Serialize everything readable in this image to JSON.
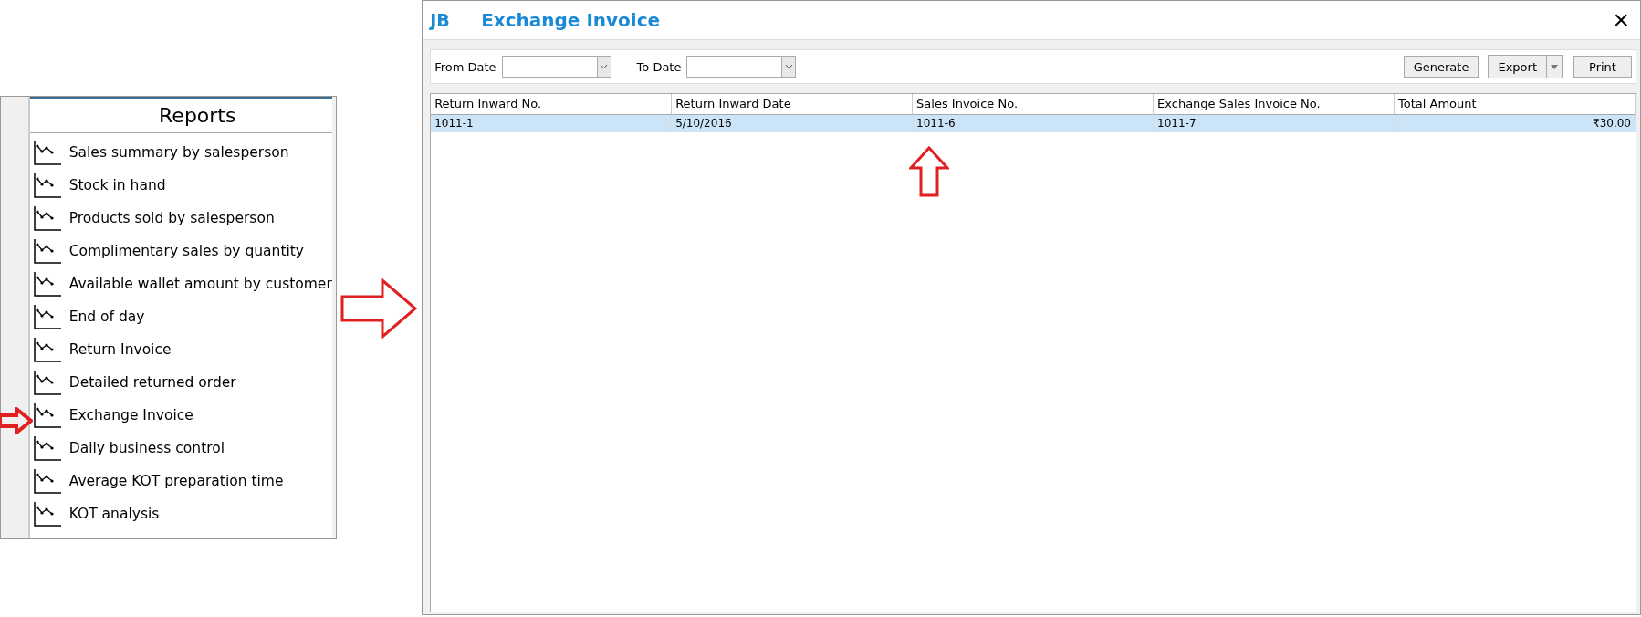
{
  "reports_panel": {
    "title": "Reports",
    "items": [
      {
        "label": "Sales summary by salesperson"
      },
      {
        "label": "Stock in hand"
      },
      {
        "label": "Products sold by salesperson"
      },
      {
        "label": "Complimentary sales by quantity"
      },
      {
        "label": "Available wallet amount by customer"
      },
      {
        "label": "End of day"
      },
      {
        "label": "Return Invoice"
      },
      {
        "label": "Detailed returned order"
      },
      {
        "label": "Exchange Invoice"
      },
      {
        "label": "Daily business control"
      },
      {
        "label": "Average KOT preparation time"
      },
      {
        "label": "KOT analysis"
      }
    ]
  },
  "window": {
    "logo": "JB",
    "title": "Exchange Invoice",
    "close": "×"
  },
  "filters": {
    "from_date": {
      "label": "From Date"
    },
    "to_date": {
      "label": "To Date"
    }
  },
  "buttons": {
    "generate": "Generate",
    "export": "Export",
    "print": "Print"
  },
  "table": {
    "columns": [
      "Return Inward No.",
      "Return Inward Date",
      "Sales Invoice No.",
      "Exchange Sales Invoice No.",
      "Total Amount"
    ],
    "rows": [
      {
        "cells": [
          "1011-1",
          "5/10/2016",
          "1011-6",
          "1011-7",
          "₹30.00"
        ],
        "selected": true
      }
    ]
  }
}
